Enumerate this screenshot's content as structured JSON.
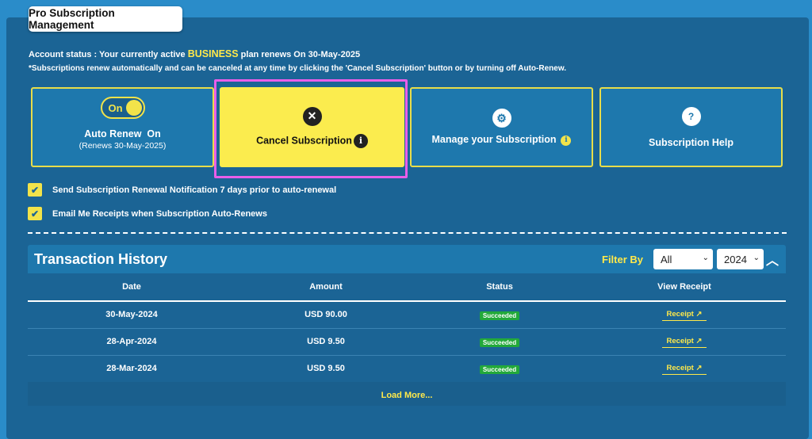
{
  "tab_title": "Pro Subscription Management",
  "account": {
    "prefix": "Account status : Your currently active ",
    "plan": "BUSINESS",
    "suffix": " plan renews On 30-May-2025",
    "note": "*Subscriptions renew automatically and can be canceled at any time by clicking the 'Cancel Subscription' button or by turning off Auto-Renew."
  },
  "cards": {
    "auto_renew": {
      "toggle_label": "On",
      "title": "Auto Renew  On",
      "subtitle": "(Renews 30-May-2025)"
    },
    "cancel": {
      "title": "Cancel Subscription"
    },
    "manage": {
      "title": "Manage your Subscription"
    },
    "help": {
      "title": "Subscription Help"
    }
  },
  "checkboxes": [
    {
      "label": "Send Subscription Renewal Notification 7 days prior to auto-renewal",
      "checked": true
    },
    {
      "label": "Email Me Receipts when Subscription Auto-Renews",
      "checked": true
    }
  ],
  "history": {
    "title": "Transaction History",
    "filter_label": "Filter By",
    "filter_type": "All",
    "filter_year": "2024",
    "columns": [
      "Date",
      "Amount",
      "Status",
      "View Receipt"
    ],
    "rows": [
      {
        "date": "30-May-2024",
        "amount": "USD 90.00",
        "status": "Succeeded",
        "receipt": "Receipt"
      },
      {
        "date": "28-Apr-2024",
        "amount": "USD 9.50",
        "status": "Succeeded",
        "receipt": "Receipt"
      },
      {
        "date": "28-Mar-2024",
        "amount": "USD 9.50",
        "status": "Succeeded",
        "receipt": "Receipt"
      }
    ],
    "load_more": "Load More..."
  },
  "colors": {
    "accent": "#ffe94a",
    "panel": "#1b6495",
    "background": "#2a8cc9",
    "success": "#23a93a",
    "highlight": "#e95ee9"
  }
}
